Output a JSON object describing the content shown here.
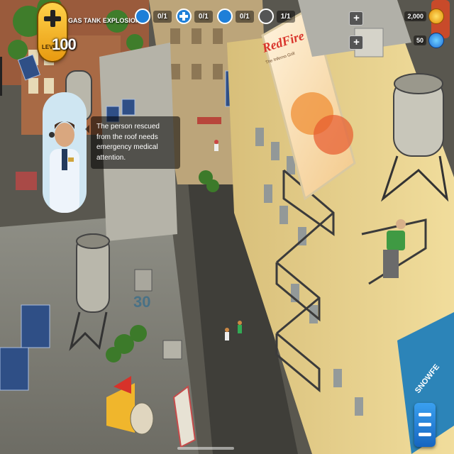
{
  "hud": {
    "level_label": "LEVEL",
    "level_value": "100",
    "mission_title": "GAS TANK EXPLOSION!",
    "objectives": [
      {
        "icon": "rescue-icon",
        "value": "0/1"
      },
      {
        "icon": "medical-cross-icon",
        "value": "0/1"
      },
      {
        "icon": "ambulance-icon",
        "value": "0/1"
      },
      {
        "icon": "tool-icon",
        "value": "1/1"
      }
    ],
    "coins": "2,000",
    "gems": "50"
  },
  "advisor": {
    "message": "The person rescued from the roof needs emergency medical attention."
  },
  "scene": {
    "billboard_brand": "RedFire",
    "billboard_sub": "The Inferno Grill",
    "road_number": "30",
    "sign_text": "SNOWFE"
  },
  "colors": {
    "accent_gold": "#f5b52a",
    "objective_blue": "#1e7fd8",
    "menu_blue": "#1e6fd8"
  }
}
